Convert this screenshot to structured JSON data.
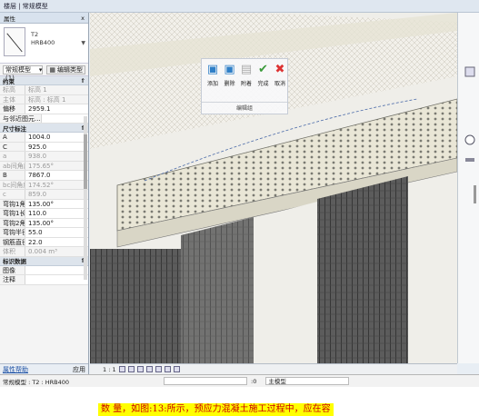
{
  "breadcrumb": "楼层 | 常规模型",
  "properties": {
    "title": "属性",
    "close": "x",
    "type_name": "T2",
    "type_sub": "HRB400",
    "selector": "常规模型 (1)",
    "edit_type": "编辑类型",
    "sections": {
      "constraints": "约束",
      "dimensions": "尺寸标注",
      "identity": "标识数据"
    },
    "constraints_rows": [
      {
        "k": "标高",
        "v": "标高 1",
        "dim": true
      },
      {
        "k": "主体",
        "v": "标高 : 标高 1",
        "dim": true
      },
      {
        "k": "偏移",
        "v": "2959.1",
        "dim": false
      },
      {
        "k": "与邻近图元...",
        "v": "",
        "dim": false,
        "wide": true
      }
    ],
    "dimension_rows": [
      {
        "k": "A",
        "v": "1004.0",
        "dim": false
      },
      {
        "k": "C",
        "v": "925.0",
        "dim": false
      },
      {
        "k": "a",
        "v": "938.0",
        "dim": true
      },
      {
        "k": "ab间角度",
        "v": "175.65°",
        "dim": true
      },
      {
        "k": "B",
        "v": "7867.0",
        "dim": false
      },
      {
        "k": "bc间角度",
        "v": "174.52°",
        "dim": true
      },
      {
        "k": "c",
        "v": "859.0",
        "dim": true
      },
      {
        "k": "弯钩1角度",
        "v": "135.00°",
        "dim": false
      },
      {
        "k": "弯钩1长度",
        "v": "110.0",
        "dim": false
      },
      {
        "k": "弯钩2角度",
        "v": "135.00°",
        "dim": false
      },
      {
        "k": "弯钩半径",
        "v": "55.0",
        "dim": false
      },
      {
        "k": "钢筋直径",
        "v": "22.0",
        "dim": false
      },
      {
        "k": "体积",
        "v": "0.004 m³",
        "dim": true
      }
    ],
    "identity_rows": [
      {
        "k": "图像",
        "v": "",
        "dim": false
      },
      {
        "k": "注释",
        "v": "",
        "dim": false
      }
    ],
    "help_link": "属性帮助",
    "apply": "应用"
  },
  "ribbon": {
    "buttons": [
      {
        "label": "添加",
        "icon": "add-icon"
      },
      {
        "label": "删除",
        "icon": "delete-icon"
      },
      {
        "label": "附着",
        "icon": "attach-icon"
      },
      {
        "label": "完成",
        "icon": "check-icon"
      },
      {
        "label": "取消",
        "icon": "cancel-icon"
      }
    ],
    "group_title": "编辑组"
  },
  "view_bar": {
    "scale": "1 : 1"
  },
  "status": {
    "message": "常规模型 : T2 : HRB400",
    "zero": ":0",
    "model": "主模型"
  },
  "caption": "数 量，如图:13:所示，预应力混凝土施工过程中，应在容",
  "colors": {
    "accent": "#1b4fa3",
    "caption_bg": "#ffff00",
    "caption_text": "#cc0000"
  }
}
